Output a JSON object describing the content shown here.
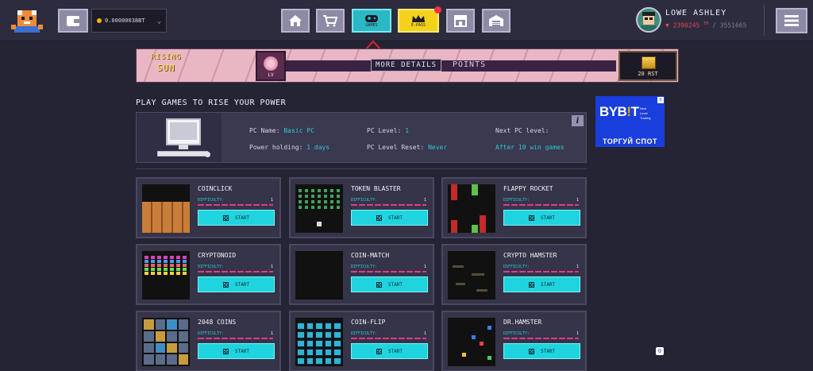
{
  "header": {
    "balance": "0.00000038BT",
    "nav": [
      {
        "name": "home",
        "label": ""
      },
      {
        "name": "shop",
        "label": ""
      },
      {
        "name": "games",
        "label": "GAMES"
      },
      {
        "name": "epass",
        "label": "E-PASS"
      },
      {
        "name": "store",
        "label": ""
      },
      {
        "name": "garage",
        "label": ""
      }
    ],
    "user": {
      "name": "LOWE ASHLEY",
      "power": "2390245",
      "power_unit": "TH",
      "power_max": "/ 3551665"
    }
  },
  "banner": {
    "event_line1": "RISING",
    "event_line2": "SUN",
    "badge_level": "LV",
    "more_details": "MORE DETAILS",
    "points_label": "POINTS",
    "reward_amount": "20 RST"
  },
  "section_title": "PLAY GAMES TO RISE YOUR POWER",
  "pc": {
    "name_label": "PC Name:",
    "name_value": "Basic PC",
    "holding_label": "Power holding:",
    "holding_value": "1 days",
    "level_label": "PC Level:",
    "level_value": "1",
    "reset_label": "PC Level Reset:",
    "reset_value": "Never",
    "next_label": "Next PC level:",
    "next_value": "After 10 win games",
    "info_label": "i"
  },
  "ad": {
    "brand_a": "BYB",
    "brand_b": "!",
    "brand_c": "T",
    "tagline_1": "Next",
    "tagline_2": "Level",
    "tagline_3": "Trading",
    "cta": "ТОРГУЙ СПОТ",
    "close": "x",
    "widget": "0"
  },
  "games": [
    {
      "name": "COINCLICK",
      "difficulty_label": "DIFFICULTY:",
      "difficulty": "1",
      "start": "START",
      "thumb": "coinclick"
    },
    {
      "name": "TOKEN BLASTER",
      "difficulty_label": "DIFFICULTY:",
      "difficulty": "1",
      "start": "START",
      "thumb": "token"
    },
    {
      "name": "FLAPPY ROCKET",
      "difficulty_label": "DIFFICULTY:",
      "difficulty": "1",
      "start": "START",
      "thumb": "flappy"
    },
    {
      "name": "CRYPTONOID",
      "difficulty_label": "DIFFICULTY:",
      "difficulty": "1",
      "start": "START",
      "thumb": "crypto"
    },
    {
      "name": "COIN-MATCH",
      "difficulty_label": "DIFFICULTY:",
      "difficulty": "1",
      "start": "START",
      "thumb": "match"
    },
    {
      "name": "CRYPTO HAMSTER",
      "difficulty_label": "DIFFICULTY:",
      "difficulty": "1",
      "start": "START",
      "thumb": "hamster"
    },
    {
      "name": "2048 COINS",
      "difficulty_label": "DIFFICULTY:",
      "difficulty": "1",
      "start": "START",
      "thumb": "2048"
    },
    {
      "name": "COIN-FLIP",
      "difficulty_label": "DIFFICULTY:",
      "difficulty": "1",
      "start": "START",
      "thumb": "flip"
    },
    {
      "name": "DR.HAMSTER",
      "difficulty_label": "DIFFICULTY:",
      "difficulty": "1",
      "start": "START",
      "thumb": "drh"
    }
  ],
  "colors": {
    "accent": "#1fd4de",
    "power": "#e64356",
    "background": "#252434",
    "epass": "#f4d21c"
  }
}
